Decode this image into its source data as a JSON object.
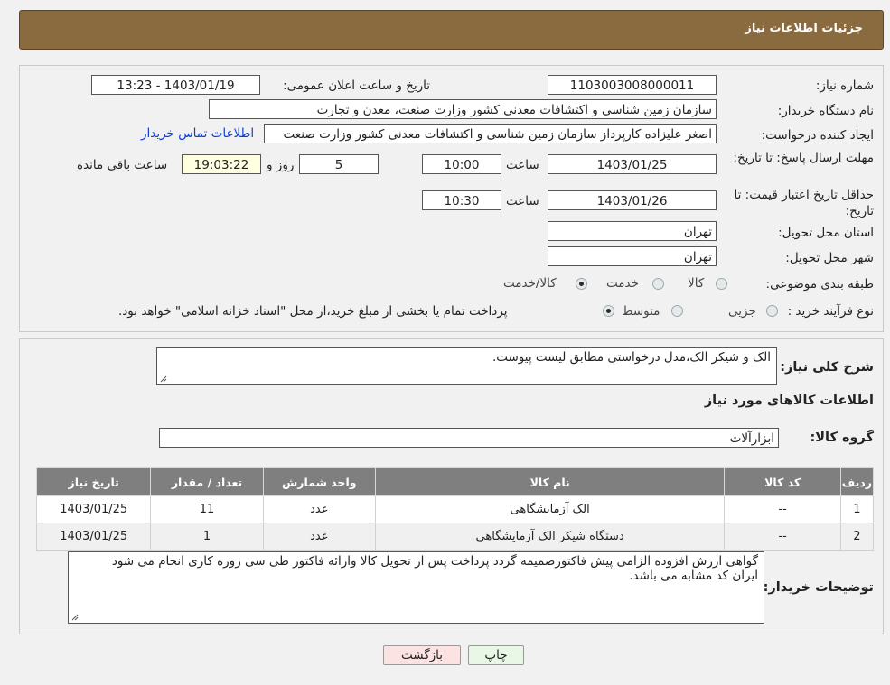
{
  "header": {
    "title": "جزئیات اطلاعات نیاز"
  },
  "form": {
    "need_number_label": "شماره نیاز:",
    "need_number": "1103003008000011",
    "announce_label": "تاریخ و ساعت اعلان عمومی:",
    "announce_value": "1403/01/19 - 13:23",
    "buyer_org_label": "نام دستگاه خریدار:",
    "buyer_org": "سازمان زمین شناسی و اکتشافات معدنی کشور وزارت صنعت، معدن و تجارت",
    "creator_label": "ایجاد کننده درخواست:",
    "creator": "اصغر علیزاده کارپرداز سازمان زمین شناسی و اکتشافات معدنی کشور وزارت صنعت",
    "contact_link": "اطلاعات تماس خریدار",
    "reply_deadline_label": "مهلت ارسال پاسخ: تا تاریخ:",
    "reply_date": "1403/01/25",
    "time_label": "ساعت",
    "reply_time": "10:00",
    "days_value": "5",
    "days_label": "روز و",
    "remaining_time": "19:03:22",
    "remaining_label": "ساعت باقی مانده",
    "price_validity_label": "حداقل تاریخ اعتبار قیمت: تا تاریخ:",
    "validity_date": "1403/01/26",
    "validity_time": "10:30",
    "province_label": "استان محل تحویل:",
    "province": "تهران",
    "city_label": "شهر محل تحویل:",
    "city": "تهران",
    "category_label": "طبقه بندی موضوعی:",
    "category_options": [
      "کالا",
      "خدمت",
      "کالا/خدمت"
    ],
    "process_label": "نوع فرآیند خرید :",
    "process_options": [
      "جزیی",
      "متوسط"
    ],
    "process_note": "پرداخت تمام یا بخشی از مبلغ خرید،از محل \"اسناد خزانه اسلامی\" خواهد بود."
  },
  "details": {
    "description_label": "شرح کلی نیاز:",
    "description": "الک و شیکر الک،مدل درخواستی مطابق لیست پیوست.",
    "goods_info_title": "اطلاعات کالاهای مورد نیاز",
    "goods_group_label": "گروه کالا:",
    "goods_group": "ابزارآلات"
  },
  "table": {
    "headers": [
      "ردیف",
      "کد کالا",
      "نام کالا",
      "واحد شمارش",
      "تعداد / مقدار",
      "تاریخ نیاز"
    ],
    "rows": [
      [
        "1",
        "--",
        "الک آزمایشگاهی",
        "عدد",
        "11",
        "1403/01/25"
      ],
      [
        "2",
        "--",
        "دستگاه شیکر الک آزمایشگاهی",
        "عدد",
        "1",
        "1403/01/25"
      ]
    ]
  },
  "buyer_notes": {
    "label": "توضیحات خریدار:",
    "line1": "گواهی ارزش افزوده الزامی پیش فاکتورضمیمه گردد پرداخت پس از تحویل کالا وارائه فاکتور طی سی روزه کاری انجام می شود",
    "line2": "ایران کد مشابه می باشد."
  },
  "buttons": {
    "print": "چاپ",
    "back": "بازگشت"
  },
  "colors": {
    "header_bg": "#8a6a3f",
    "table_header_bg": "#7f7f7f",
    "link": "#0b3dd6"
  }
}
